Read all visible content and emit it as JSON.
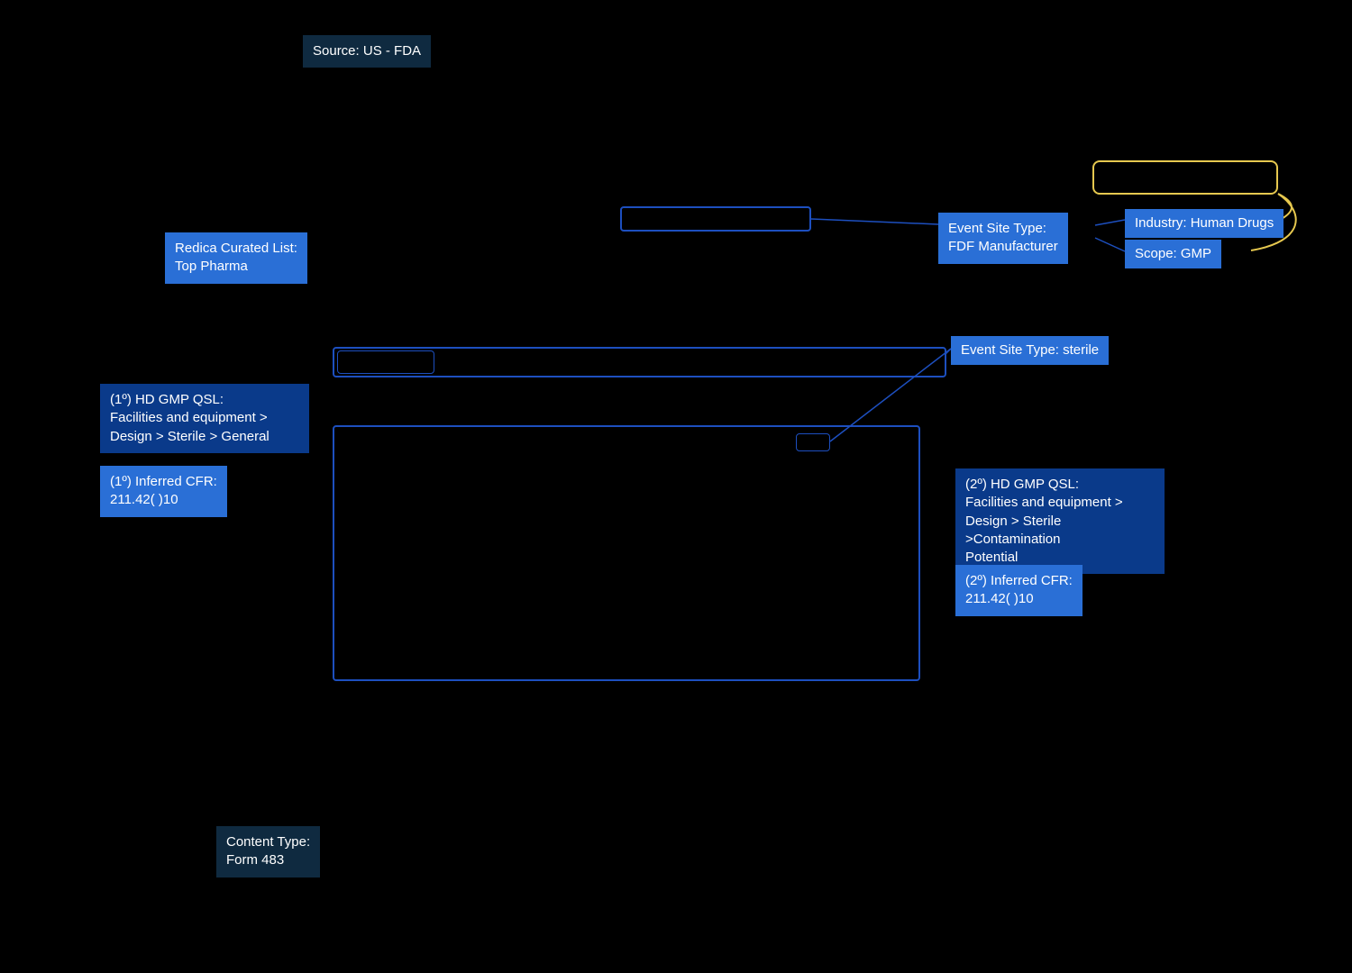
{
  "source": {
    "label": "Source: US - FDA"
  },
  "redica": {
    "label": "Redica Curated List:\nTop Pharma"
  },
  "qsl1": {
    "label": "(1º) HD GMP QSL:\nFacilities and equipment >\nDesign > Sterile > General"
  },
  "cfr1": {
    "label": "(1º) Inferred CFR:\n211.42(  )10"
  },
  "contentType": {
    "label": "Content Type:\nForm 483"
  },
  "eventSiteFdf": {
    "label": "Event Site Type:\nFDF Manufacturer"
  },
  "industry": {
    "label": "Industry: Human Drugs"
  },
  "scope": {
    "label": "Scope: GMP"
  },
  "eventSiteSterile": {
    "label": "Event Site Type: sterile"
  },
  "qsl2": {
    "label": "(2º) HD GMP QSL:\nFacilities and equipment >\nDesign > Sterile >Contamination\nPotential"
  },
  "cfr2": {
    "label": "(2º) Inferred CFR:\n211.42(  )10"
  }
}
